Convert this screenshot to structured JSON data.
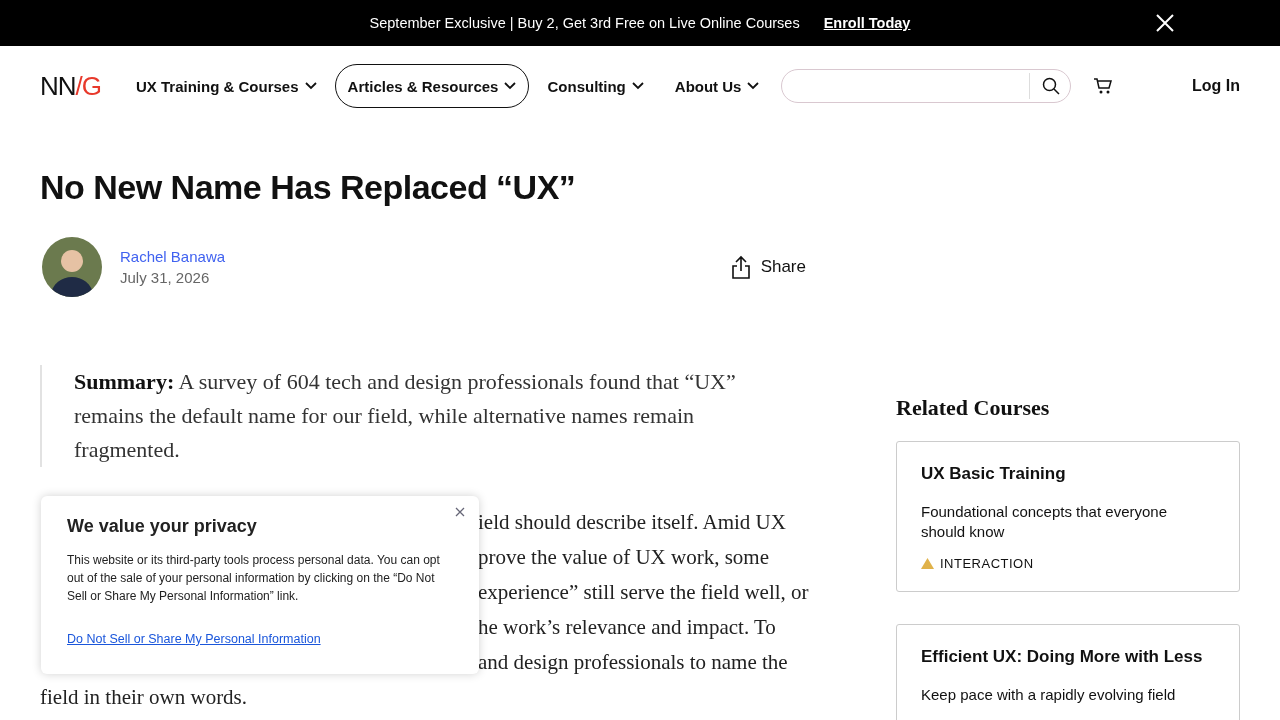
{
  "banner": {
    "text": "September Exclusive | Buy 2, Get 3rd Free on Live Online Courses",
    "link": "Enroll Today"
  },
  "nav": {
    "logo": {
      "text": "NN",
      "accent": "/G"
    },
    "items": [
      {
        "label": "UX Training & Courses",
        "selected": false
      },
      {
        "label": "Articles & Resources",
        "selected": true
      },
      {
        "label": "Consulting",
        "selected": false
      },
      {
        "label": "About Us",
        "selected": false
      }
    ],
    "login": "Log In"
  },
  "article": {
    "title": "No New Name Has Replaced “UX”",
    "author": "Rachel Banawa",
    "date": "July 31, 2026",
    "share": "Share",
    "summary": "**Summary:**  A survey of 604 tech and design professionals found that “UX” remains the default name for our field, while alternative names remain fragmented.",
    "body_visible_fragments": [
      "ield should describe itself. Amid UX",
      "prove the value of UX work, some",
      "experience” still serve the field well, or",
      "he work’s relevance and impact. To",
      "and design professionals to name the"
    ],
    "body_last_line": "field in their own words."
  },
  "sidebar": {
    "heading": "Related Courses",
    "courses": [
      {
        "title": "UX Basic Training",
        "description": "Foundational concepts that everyone should know",
        "tag": "INTERACTION",
        "color": "#e0b24a"
      },
      {
        "title": "Efficient UX: Doing More with Less",
        "description": "Keep pace with a rapidly evolving field"
      }
    ]
  },
  "cookie_popup": {
    "title": "We value your privacy",
    "text": "This website or its third-party tools process personal data. You can opt out of the sale of your personal information by clicking on the “Do Not Sell or Share My Personal Information” link.",
    "link": "Do Not Sell or Share My Personal Information"
  }
}
